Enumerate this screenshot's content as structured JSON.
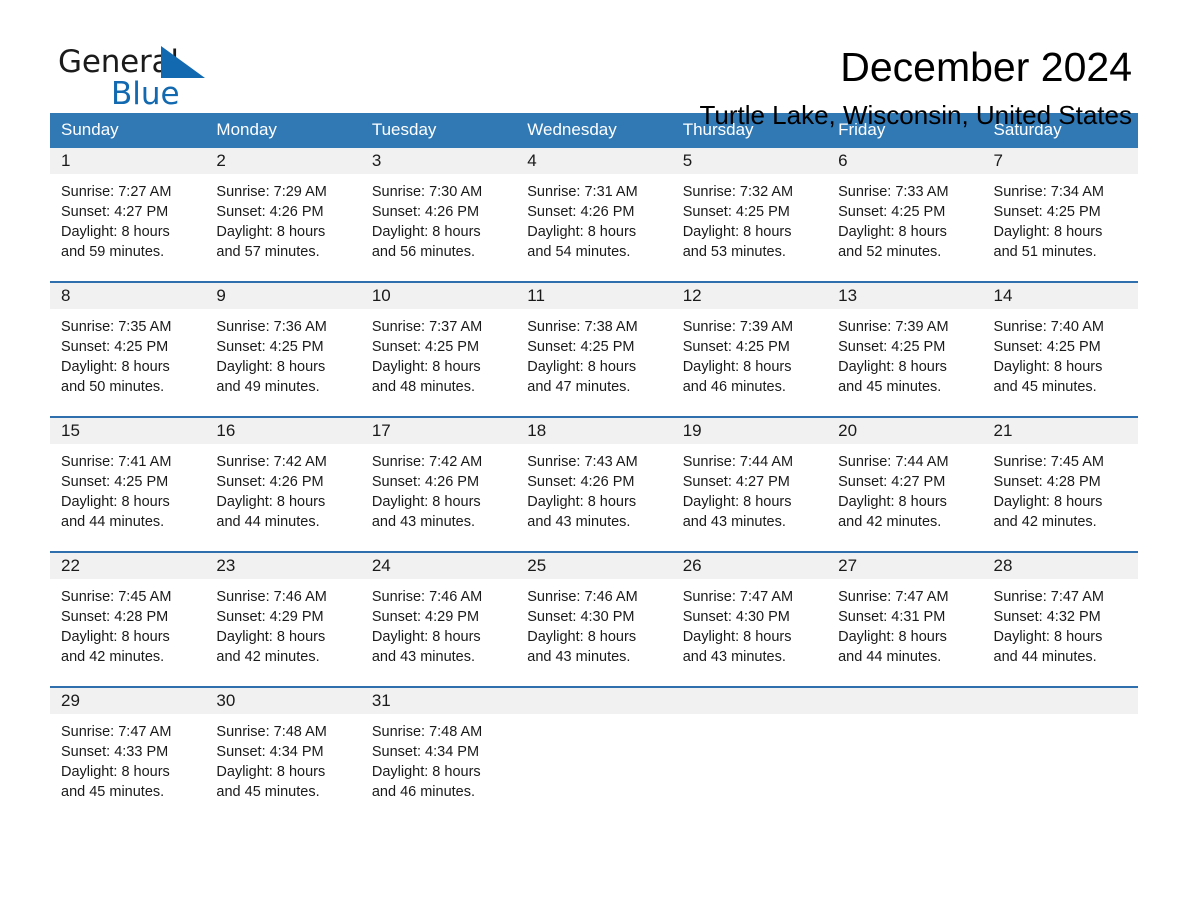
{
  "brand": {
    "name_top": "General",
    "name_bottom": "Blue",
    "triangle_icon": "blue-triangle-logo-mark",
    "accent_color": "#1269b0"
  },
  "header": {
    "month_title": "December 2024",
    "location": "Turtle Lake, Wisconsin, United States"
  },
  "calendar": {
    "header_bg": "#3079b5",
    "header_text_color": "#ffffff",
    "row_divider_color": "#2f6fae",
    "daynum_band_bg": "#f1f1f1",
    "weekdays": [
      "Sunday",
      "Monday",
      "Tuesday",
      "Wednesday",
      "Thursday",
      "Friday",
      "Saturday"
    ],
    "weeks": [
      [
        {
          "day": "1",
          "sunrise": "Sunrise: 7:27 AM",
          "sunset": "Sunset: 4:27 PM",
          "daylight_line1": "Daylight: 8 hours",
          "daylight_line2": "and 59 minutes."
        },
        {
          "day": "2",
          "sunrise": "Sunrise: 7:29 AM",
          "sunset": "Sunset: 4:26 PM",
          "daylight_line1": "Daylight: 8 hours",
          "daylight_line2": "and 57 minutes."
        },
        {
          "day": "3",
          "sunrise": "Sunrise: 7:30 AM",
          "sunset": "Sunset: 4:26 PM",
          "daylight_line1": "Daylight: 8 hours",
          "daylight_line2": "and 56 minutes."
        },
        {
          "day": "4",
          "sunrise": "Sunrise: 7:31 AM",
          "sunset": "Sunset: 4:26 PM",
          "daylight_line1": "Daylight: 8 hours",
          "daylight_line2": "and 54 minutes."
        },
        {
          "day": "5",
          "sunrise": "Sunrise: 7:32 AM",
          "sunset": "Sunset: 4:25 PM",
          "daylight_line1": "Daylight: 8 hours",
          "daylight_line2": "and 53 minutes."
        },
        {
          "day": "6",
          "sunrise": "Sunrise: 7:33 AM",
          "sunset": "Sunset: 4:25 PM",
          "daylight_line1": "Daylight: 8 hours",
          "daylight_line2": "and 52 minutes."
        },
        {
          "day": "7",
          "sunrise": "Sunrise: 7:34 AM",
          "sunset": "Sunset: 4:25 PM",
          "daylight_line1": "Daylight: 8 hours",
          "daylight_line2": "and 51 minutes."
        }
      ],
      [
        {
          "day": "8",
          "sunrise": "Sunrise: 7:35 AM",
          "sunset": "Sunset: 4:25 PM",
          "daylight_line1": "Daylight: 8 hours",
          "daylight_line2": "and 50 minutes."
        },
        {
          "day": "9",
          "sunrise": "Sunrise: 7:36 AM",
          "sunset": "Sunset: 4:25 PM",
          "daylight_line1": "Daylight: 8 hours",
          "daylight_line2": "and 49 minutes."
        },
        {
          "day": "10",
          "sunrise": "Sunrise: 7:37 AM",
          "sunset": "Sunset: 4:25 PM",
          "daylight_line1": "Daylight: 8 hours",
          "daylight_line2": "and 48 minutes."
        },
        {
          "day": "11",
          "sunrise": "Sunrise: 7:38 AM",
          "sunset": "Sunset: 4:25 PM",
          "daylight_line1": "Daylight: 8 hours",
          "daylight_line2": "and 47 minutes."
        },
        {
          "day": "12",
          "sunrise": "Sunrise: 7:39 AM",
          "sunset": "Sunset: 4:25 PM",
          "daylight_line1": "Daylight: 8 hours",
          "daylight_line2": "and 46 minutes."
        },
        {
          "day": "13",
          "sunrise": "Sunrise: 7:39 AM",
          "sunset": "Sunset: 4:25 PM",
          "daylight_line1": "Daylight: 8 hours",
          "daylight_line2": "and 45 minutes."
        },
        {
          "day": "14",
          "sunrise": "Sunrise: 7:40 AM",
          "sunset": "Sunset: 4:25 PM",
          "daylight_line1": "Daylight: 8 hours",
          "daylight_line2": "and 45 minutes."
        }
      ],
      [
        {
          "day": "15",
          "sunrise": "Sunrise: 7:41 AM",
          "sunset": "Sunset: 4:25 PM",
          "daylight_line1": "Daylight: 8 hours",
          "daylight_line2": "and 44 minutes."
        },
        {
          "day": "16",
          "sunrise": "Sunrise: 7:42 AM",
          "sunset": "Sunset: 4:26 PM",
          "daylight_line1": "Daylight: 8 hours",
          "daylight_line2": "and 44 minutes."
        },
        {
          "day": "17",
          "sunrise": "Sunrise: 7:42 AM",
          "sunset": "Sunset: 4:26 PM",
          "daylight_line1": "Daylight: 8 hours",
          "daylight_line2": "and 43 minutes."
        },
        {
          "day": "18",
          "sunrise": "Sunrise: 7:43 AM",
          "sunset": "Sunset: 4:26 PM",
          "daylight_line1": "Daylight: 8 hours",
          "daylight_line2": "and 43 minutes."
        },
        {
          "day": "19",
          "sunrise": "Sunrise: 7:44 AM",
          "sunset": "Sunset: 4:27 PM",
          "daylight_line1": "Daylight: 8 hours",
          "daylight_line2": "and 43 minutes."
        },
        {
          "day": "20",
          "sunrise": "Sunrise: 7:44 AM",
          "sunset": "Sunset: 4:27 PM",
          "daylight_line1": "Daylight: 8 hours",
          "daylight_line2": "and 42 minutes."
        },
        {
          "day": "21",
          "sunrise": "Sunrise: 7:45 AM",
          "sunset": "Sunset: 4:28 PM",
          "daylight_line1": "Daylight: 8 hours",
          "daylight_line2": "and 42 minutes."
        }
      ],
      [
        {
          "day": "22",
          "sunrise": "Sunrise: 7:45 AM",
          "sunset": "Sunset: 4:28 PM",
          "daylight_line1": "Daylight: 8 hours",
          "daylight_line2": "and 42 minutes."
        },
        {
          "day": "23",
          "sunrise": "Sunrise: 7:46 AM",
          "sunset": "Sunset: 4:29 PM",
          "daylight_line1": "Daylight: 8 hours",
          "daylight_line2": "and 42 minutes."
        },
        {
          "day": "24",
          "sunrise": "Sunrise: 7:46 AM",
          "sunset": "Sunset: 4:29 PM",
          "daylight_line1": "Daylight: 8 hours",
          "daylight_line2": "and 43 minutes."
        },
        {
          "day": "25",
          "sunrise": "Sunrise: 7:46 AM",
          "sunset": "Sunset: 4:30 PM",
          "daylight_line1": "Daylight: 8 hours",
          "daylight_line2": "and 43 minutes."
        },
        {
          "day": "26",
          "sunrise": "Sunrise: 7:47 AM",
          "sunset": "Sunset: 4:30 PM",
          "daylight_line1": "Daylight: 8 hours",
          "daylight_line2": "and 43 minutes."
        },
        {
          "day": "27",
          "sunrise": "Sunrise: 7:47 AM",
          "sunset": "Sunset: 4:31 PM",
          "daylight_line1": "Daylight: 8 hours",
          "daylight_line2": "and 44 minutes."
        },
        {
          "day": "28",
          "sunrise": "Sunrise: 7:47 AM",
          "sunset": "Sunset: 4:32 PM",
          "daylight_line1": "Daylight: 8 hours",
          "daylight_line2": "and 44 minutes."
        }
      ],
      [
        {
          "day": "29",
          "sunrise": "Sunrise: 7:47 AM",
          "sunset": "Sunset: 4:33 PM",
          "daylight_line1": "Daylight: 8 hours",
          "daylight_line2": "and 45 minutes."
        },
        {
          "day": "30",
          "sunrise": "Sunrise: 7:48 AM",
          "sunset": "Sunset: 4:34 PM",
          "daylight_line1": "Daylight: 8 hours",
          "daylight_line2": "and 45 minutes."
        },
        {
          "day": "31",
          "sunrise": "Sunrise: 7:48 AM",
          "sunset": "Sunset: 4:34 PM",
          "daylight_line1": "Daylight: 8 hours",
          "daylight_line2": "and 46 minutes."
        },
        {
          "day": "",
          "sunrise": "",
          "sunset": "",
          "daylight_line1": "",
          "daylight_line2": ""
        },
        {
          "day": "",
          "sunrise": "",
          "sunset": "",
          "daylight_line1": "",
          "daylight_line2": ""
        },
        {
          "day": "",
          "sunrise": "",
          "sunset": "",
          "daylight_line1": "",
          "daylight_line2": ""
        },
        {
          "day": "",
          "sunrise": "",
          "sunset": "",
          "daylight_line1": "",
          "daylight_line2": ""
        }
      ]
    ]
  }
}
